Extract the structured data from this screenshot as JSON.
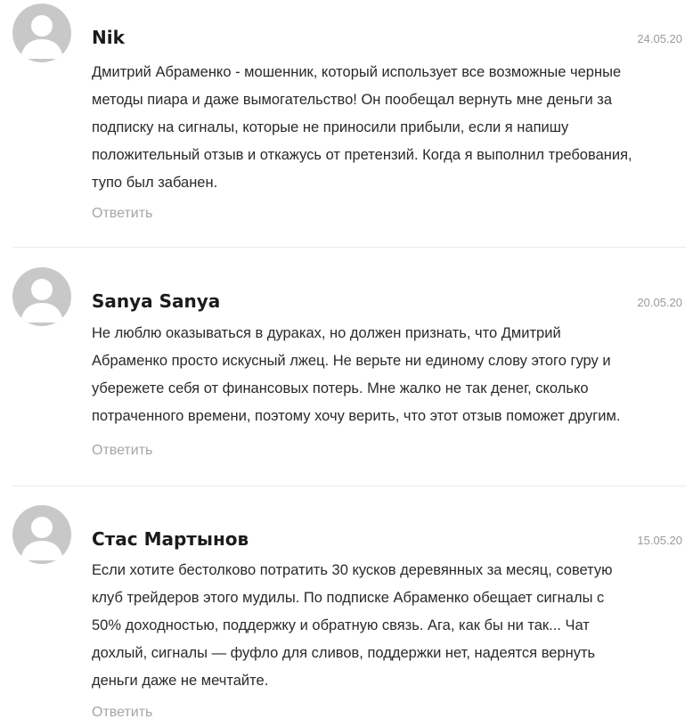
{
  "comments": [
    {
      "author": "Nik",
      "date": "24.05.20",
      "lines": [
        "Дмитрий Абраменко - мошенник, который использует все возможные черные",
        "методы пиара и даже вымогательство! Он пообещал вернуть мне деньги за",
        "подписку на сигналы, которые не приносили прибыли, если я напишу",
        "положительный отзыв и откажусь от претензий. Когда я выполнил требования,",
        "тупо был забанен."
      ],
      "reply_label": "Ответить"
    },
    {
      "author": "Sanya Sanya",
      "date": "20.05.20",
      "lines": [
        "Не люблю оказываться в дураках, но должен признать, что Дмитрий",
        "Абраменко просто искусный лжец. Не верьте ни единому слову этого гуру и",
        "убережете себя от финансовых потерь. Мне жалко не так денег, сколько",
        "потраченного времени, поэтому хочу верить, что этот отзыв поможет другим."
      ],
      "reply_label": "Ответить"
    },
    {
      "author": "Стас Мартынов",
      "date": "15.05.20",
      "lines": [
        "Если хотите бестолково потратить 30 кусков деревянных за месяц, советую",
        "клуб трейдеров этого мудилы. По подписке Абраменко обещает сигналы с",
        "50% доходностью, поддержку и обратную связь. Ага, как бы ни так... Чат",
        "дохлый, сигналы — фуфло для сливов, поддержки нет, надеятся вернуть",
        "деньги даже не мечтайте."
      ],
      "reply_label": "Ответить"
    }
  ]
}
